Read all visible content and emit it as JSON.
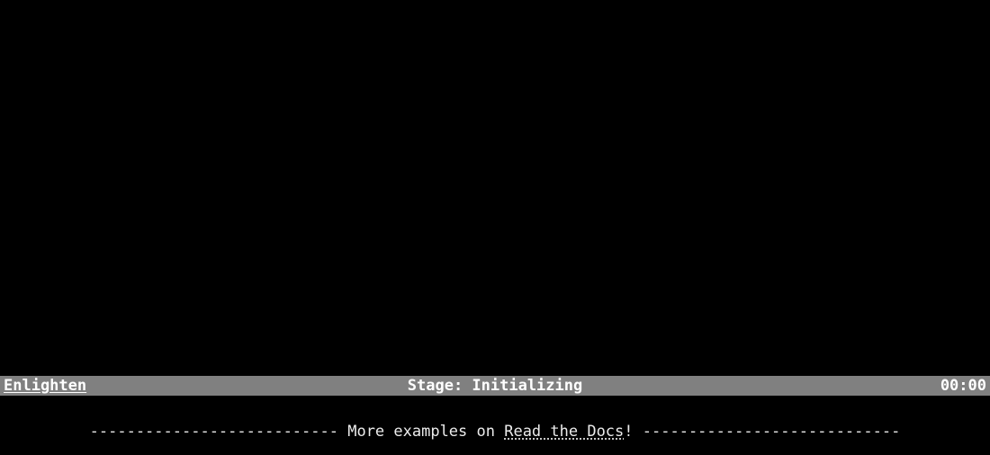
{
  "status": {
    "left": "Enlighten",
    "center": "Stage: Initializing",
    "right": "00:00"
  },
  "footer": {
    "dashes_left": "--------------------------- ",
    "text_before_link": "More examples on ",
    "link_text": "Read the Docs",
    "text_after_link": "! ",
    "dashes_right": "----------------------------"
  }
}
